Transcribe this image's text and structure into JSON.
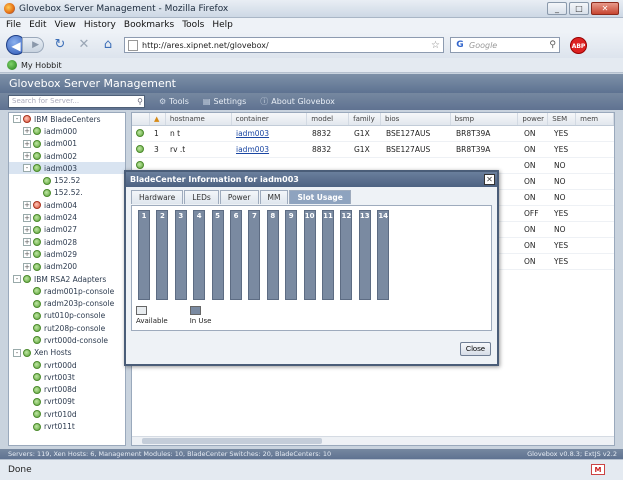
{
  "window": {
    "title": "Glovebox Server Management - Mozilla Firefox",
    "min": "_",
    "max": "□",
    "close": "✕"
  },
  "menu": [
    "File",
    "Edit",
    "View",
    "History",
    "Bookmarks",
    "Tools",
    "Help"
  ],
  "nav": {
    "url": "http://ares.xipnet.net/glovebox/",
    "search_placeholder": "Google",
    "abp_label": "ABP"
  },
  "bookmarks": {
    "item": "My Hobbit"
  },
  "app": {
    "title": "Glovebox Server Management",
    "search_placeholder": "Search for Server...",
    "toolbar": {
      "tools": "Tools",
      "settings": "Settings",
      "about": "About Glovebox"
    }
  },
  "tree": [
    {
      "label": "IBM BladeCenters",
      "level": 0,
      "toggle": "-",
      "status": "warn"
    },
    {
      "label": "iadm000",
      "level": 1,
      "toggle": "+",
      "status": "ok"
    },
    {
      "label": "iadm001",
      "level": 1,
      "toggle": "+",
      "status": "ok"
    },
    {
      "label": "iadm002",
      "level": 1,
      "toggle": "+",
      "status": "ok"
    },
    {
      "label": "iadm003",
      "level": 1,
      "toggle": "-",
      "status": "ok",
      "selected": true
    },
    {
      "label": "152.52",
      "level": 2,
      "toggle": "",
      "status": "ok"
    },
    {
      "label": "152.52.",
      "level": 2,
      "toggle": "",
      "status": "ok"
    },
    {
      "label": "iadm004",
      "level": 1,
      "toggle": "+",
      "status": "warn"
    },
    {
      "label": "iadm024",
      "level": 1,
      "toggle": "+",
      "status": "ok"
    },
    {
      "label": "iadm027",
      "level": 1,
      "toggle": "+",
      "status": "ok"
    },
    {
      "label": "iadm028",
      "level": 1,
      "toggle": "+",
      "status": "ok"
    },
    {
      "label": "iadm029",
      "level": 1,
      "toggle": "+",
      "status": "ok"
    },
    {
      "label": "iadm200",
      "level": 1,
      "toggle": "+",
      "status": "ok"
    },
    {
      "label": "IBM RSA2 Adapters",
      "level": 0,
      "toggle": "-",
      "status": "ok"
    },
    {
      "label": "radm001p-console",
      "level": 1,
      "toggle": "",
      "status": "ok"
    },
    {
      "label": "radm203p-console",
      "level": 1,
      "toggle": "",
      "status": "ok"
    },
    {
      "label": "rut010p-console",
      "level": 1,
      "toggle": "",
      "status": "ok"
    },
    {
      "label": "rut208p-console",
      "level": 1,
      "toggle": "",
      "status": "ok"
    },
    {
      "label": "rvrt000d-console",
      "level": 1,
      "toggle": "",
      "status": "ok"
    },
    {
      "label": "Xen Hosts",
      "level": 0,
      "toggle": "-",
      "status": "ok"
    },
    {
      "label": "rvrt000d",
      "level": 1,
      "toggle": "",
      "status": "ok"
    },
    {
      "label": "rvrt003t",
      "level": 1,
      "toggle": "",
      "status": "ok"
    },
    {
      "label": "rvrt008d",
      "level": 1,
      "toggle": "",
      "status": "ok"
    },
    {
      "label": "rvrt009t",
      "level": 1,
      "toggle": "",
      "status": "ok"
    },
    {
      "label": "rvrt010d",
      "level": 1,
      "toggle": "",
      "status": "ok"
    },
    {
      "label": "rvrt011t",
      "level": 1,
      "toggle": "",
      "status": "ok"
    }
  ],
  "grid": {
    "columns": [
      "",
      "▲",
      "hostname",
      "container",
      "model",
      "family",
      "bios",
      "bsmp",
      "power",
      "SEM",
      "mem"
    ],
    "rows": [
      [
        "",
        "1",
        "n    t",
        "iadm003",
        "8832",
        "G1X",
        "BSE127AUS",
        "BR8T39A",
        "ON",
        "YES"
      ],
      [
        "",
        "3",
        "rv       .t",
        "iadm003",
        "8832",
        "G1X",
        "BSE127AUS",
        "BR8T39A",
        "ON",
        "YES"
      ],
      [
        "",
        "",
        "",
        "",
        "",
        "",
        "",
        "",
        "ON",
        "NO"
      ],
      [
        "",
        "",
        "",
        "",
        "",
        "",
        "",
        "",
        "ON",
        "NO"
      ],
      [
        "",
        "",
        "",
        "",
        "",
        "",
        "",
        "",
        "ON",
        "NO"
      ],
      [
        "",
        "",
        "",
        "",
        "",
        "",
        "",
        "",
        "OFF",
        "YES"
      ],
      [
        "",
        "",
        "",
        "",
        "",
        "",
        "",
        "",
        "ON",
        "NO"
      ],
      [
        "",
        "",
        "",
        "",
        "",
        "",
        "",
        "",
        "ON",
        "YES"
      ],
      [
        "",
        "",
        "",
        "",
        "",
        "",
        "",
        "",
        "ON",
        "YES"
      ]
    ]
  },
  "status": {
    "summary": "Servers: 119, Xen Hosts: 6, Management Modules: 10, BladeCenter Switches: 20, BladeCenters: 10",
    "version": "Glovebox v0.8.3; ExtJS v2.2",
    "ff": "Done",
    "mail_icon_label": "M"
  },
  "modal": {
    "title": "BladeCenter Information for iadm003",
    "close": "✕",
    "tabs": [
      "Hardware",
      "LEDs",
      "Power",
      "MM",
      "Slot Usage"
    ],
    "active_tab": 4,
    "slots": [
      {
        "num": "1",
        "in_use": true
      },
      {
        "num": "2",
        "in_use": true
      },
      {
        "num": "3",
        "in_use": true
      },
      {
        "num": "4",
        "in_use": true
      },
      {
        "num": "5",
        "in_use": true
      },
      {
        "num": "6",
        "in_use": true
      },
      {
        "num": "7",
        "in_use": true
      },
      {
        "num": "8",
        "in_use": true
      },
      {
        "num": "9",
        "in_use": true
      },
      {
        "num": "10",
        "in_use": true
      },
      {
        "num": "11",
        "in_use": true
      },
      {
        "num": "12",
        "in_use": true
      },
      {
        "num": "13",
        "in_use": true
      },
      {
        "num": "14",
        "in_use": true
      }
    ],
    "legend": {
      "available": "Available",
      "in_use": "In Use"
    },
    "close_button": "Close"
  }
}
